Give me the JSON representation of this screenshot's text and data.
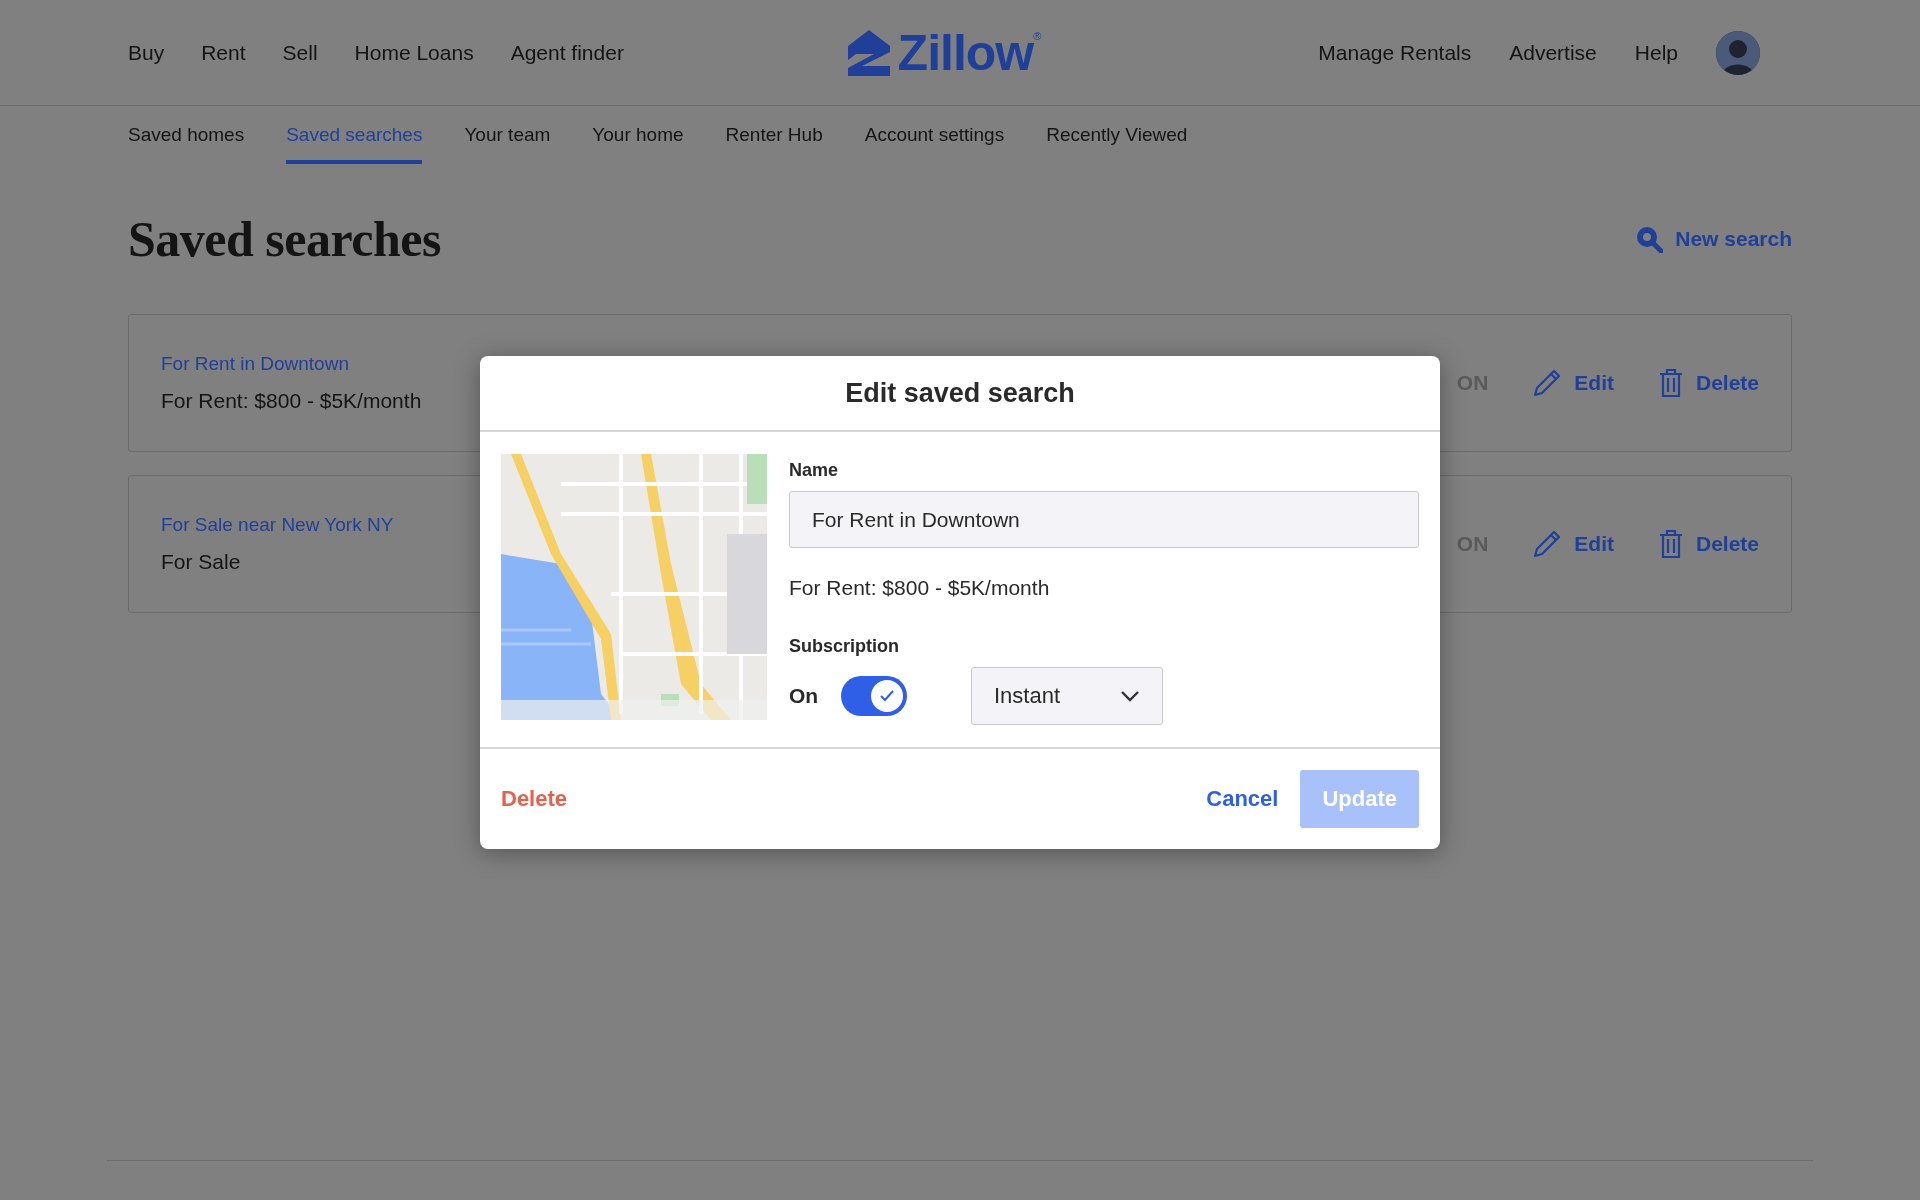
{
  "top_nav": {
    "left_links": [
      "Buy",
      "Rent",
      "Sell",
      "Home Loans",
      "Agent finder"
    ],
    "logo": "Zillow",
    "logo_mark": "®",
    "right_links": [
      "Manage Rentals",
      "Advertise",
      "Help"
    ]
  },
  "sub_nav": [
    {
      "label": "Saved homes",
      "selected": false
    },
    {
      "label": "Saved searches",
      "selected": true
    },
    {
      "label": "Your team",
      "selected": false
    },
    {
      "label": "Your home",
      "selected": false
    },
    {
      "label": "Renter Hub",
      "selected": false
    },
    {
      "label": "Account settings",
      "selected": false
    },
    {
      "label": "Recently Viewed",
      "selected": false
    }
  ],
  "page": {
    "title": "Saved searches",
    "new_search": "New search"
  },
  "saved_searches": [
    {
      "name": "For Rent in Downtown",
      "criteria": "For Rent: $800 - $5K/month",
      "status": "ON",
      "edit": "Edit",
      "delete": "Delete"
    },
    {
      "name": "For Sale near New York NY",
      "criteria": "For Sale",
      "status": "ON",
      "edit": "Edit",
      "delete": "Delete"
    }
  ],
  "dialog": {
    "title": "Edit saved search",
    "name_label": "Name",
    "name_value": "For Rent in Downtown",
    "criteria": "For Rent: $800 - $5K/month",
    "subscription_label": "Subscription",
    "toggle_label": "On",
    "subscription_on": true,
    "frequency": "Instant",
    "delete": "Delete",
    "cancel": "Cancel",
    "update": {
      "label": "Update",
      "disabled": true
    }
  }
}
